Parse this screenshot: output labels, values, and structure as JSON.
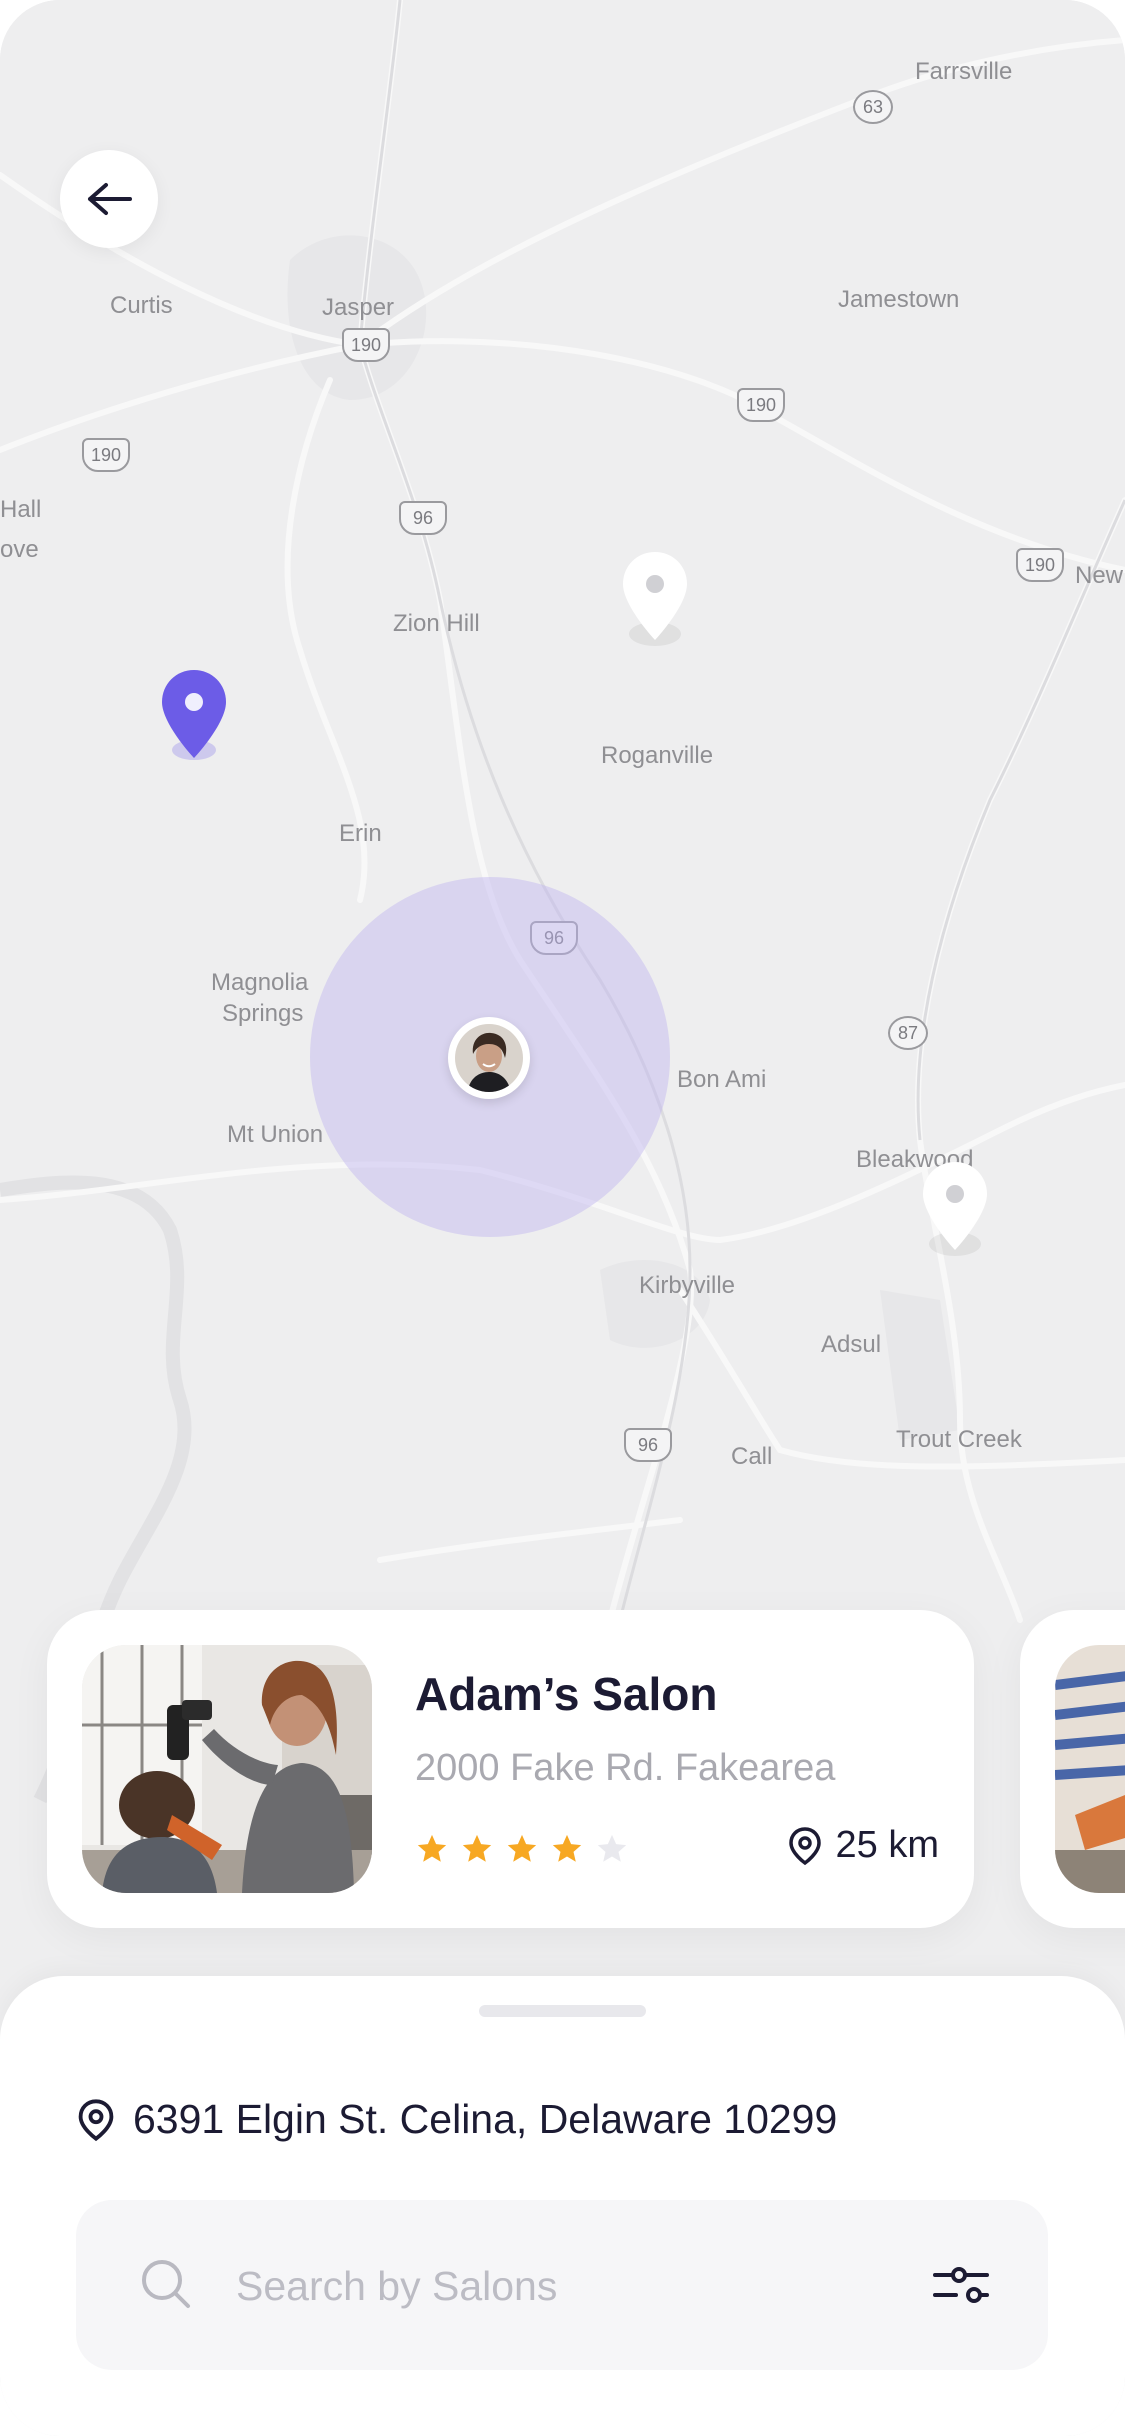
{
  "colors": {
    "accent": "#6C5CE7",
    "text_dark": "#1C1B33",
    "text_muted": "#A9A9B0",
    "star_filled": "#F7A823",
    "star_empty": "#E9E9EE",
    "radius_fill": "#BEB4F0"
  },
  "map": {
    "places": [
      "Farrsville",
      "Curtis",
      "Jasper",
      "Jamestown",
      "Hall",
      "ove",
      "New",
      "Zion Hill",
      "Roganville",
      "Erin",
      "Magnolia",
      "Springs",
      "Mt Union",
      "Bon Ami",
      "Bleakwood",
      "Kirbyville",
      "Adsul",
      "Trout Creek",
      "Call"
    ],
    "routes": [
      "63",
      "190",
      "190",
      "190",
      "190",
      "96",
      "96",
      "87",
      "96"
    ]
  },
  "back_button": {
    "icon": "arrow-left-icon"
  },
  "salon_card": {
    "name": "Adam’s Salon",
    "address": "2000 Fake Rd. Fakearea",
    "rating": 4,
    "rating_max": 5,
    "distance": "25 km"
  },
  "sheet": {
    "location": "6391 Elgin St. Celina, Delaware 10299",
    "search_placeholder": "Search by Salons",
    "filter_icon": "sliders-icon"
  }
}
